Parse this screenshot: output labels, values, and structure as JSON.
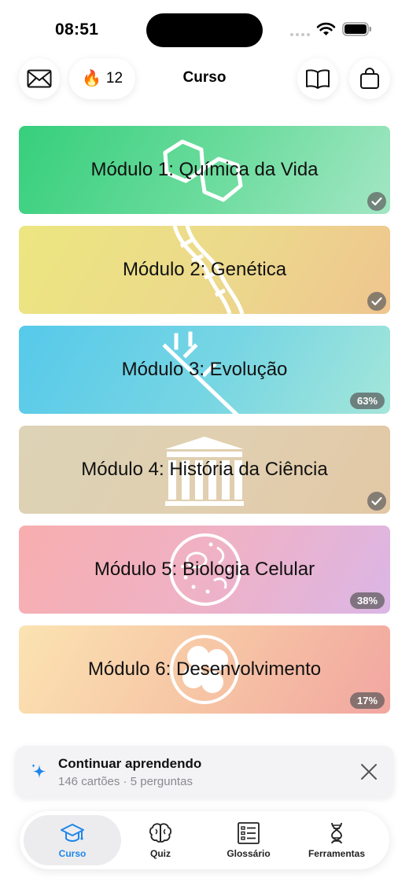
{
  "status_bar": {
    "time": "08:51"
  },
  "header": {
    "title": "Curso",
    "streak_count": "12",
    "streak_icon": "🔥"
  },
  "modules": [
    {
      "title": "Módulo 1: Química da Vida",
      "status": "complete",
      "colors": [
        "#36cf7c",
        "#a3e6c4"
      ]
    },
    {
      "title": "Módulo 2: Genética",
      "status": "complete",
      "colors": [
        "#ece680",
        "#efc58f"
      ]
    },
    {
      "title": "Módulo 3: Evolução",
      "progress_label": "63%",
      "progress": 63,
      "colors": [
        "#56c9ea",
        "#a4e6da"
      ]
    },
    {
      "title": "Módulo 4: História da Ciência",
      "status": "complete",
      "colors": [
        "#ddd3b6",
        "#e3c8a5"
      ]
    },
    {
      "title": "Módulo 5: Biologia Celular",
      "progress_label": "38%",
      "progress": 38,
      "colors": [
        "#f8aeae",
        "#dbb6e6"
      ]
    },
    {
      "title": "Módulo 6: Desenvolvimento",
      "progress_label": "17%",
      "progress": 17,
      "colors": [
        "#fbe3b2",
        "#f2a6a1"
      ]
    }
  ],
  "continue_banner": {
    "title": "Continuar aprendendo",
    "subtitle": "146 cartões · 5 perguntas"
  },
  "tabs": [
    {
      "label": "Curso",
      "icon": "graduation-cap-icon",
      "active": true
    },
    {
      "label": "Quiz",
      "icon": "brain-icon",
      "active": false
    },
    {
      "label": "Glossário",
      "icon": "list-icon",
      "active": false
    },
    {
      "label": "Ferramentas",
      "icon": "dna-icon",
      "active": false
    }
  ],
  "accent_color": "#1f86ea"
}
